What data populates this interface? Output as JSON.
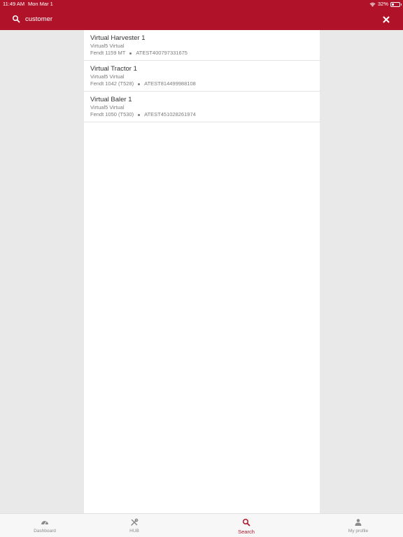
{
  "status": {
    "time": "11:49 AM",
    "date": "Mon Mar 1",
    "battery": "32%",
    "battery_level": 0.32
  },
  "search": {
    "value": "customer"
  },
  "results": [
    {
      "title": "Virtual Harvester 1",
      "subtitle": "Virtual5 Virtual",
      "model": "Fendt 1159 MT",
      "serial": "ATEST400797331675"
    },
    {
      "title": "Virtual Tractor 1",
      "subtitle": "Virtual5 Virtual",
      "model": "Fendt 1042 (T528)",
      "serial": "ATEST814499988108"
    },
    {
      "title": "Virtual Baler 1",
      "subtitle": "Virtual5 Virtual",
      "model": "Fendt 1050 (T530)",
      "serial": "ATEST451028261974"
    }
  ],
  "tabs": {
    "dashboard": {
      "label": "Dashboard",
      "icon": "gauge-icon"
    },
    "hub": {
      "label": "HUB",
      "icon": "tools-icon"
    },
    "search": {
      "label": "Search",
      "icon": "search-icon"
    },
    "profile": {
      "label": "My profile",
      "icon": "person-icon"
    }
  },
  "colors": {
    "brand": "#b01329",
    "text_primary": "#333333",
    "text_secondary": "#7b7b7b",
    "tab_inactive": "#8a8a8a"
  }
}
